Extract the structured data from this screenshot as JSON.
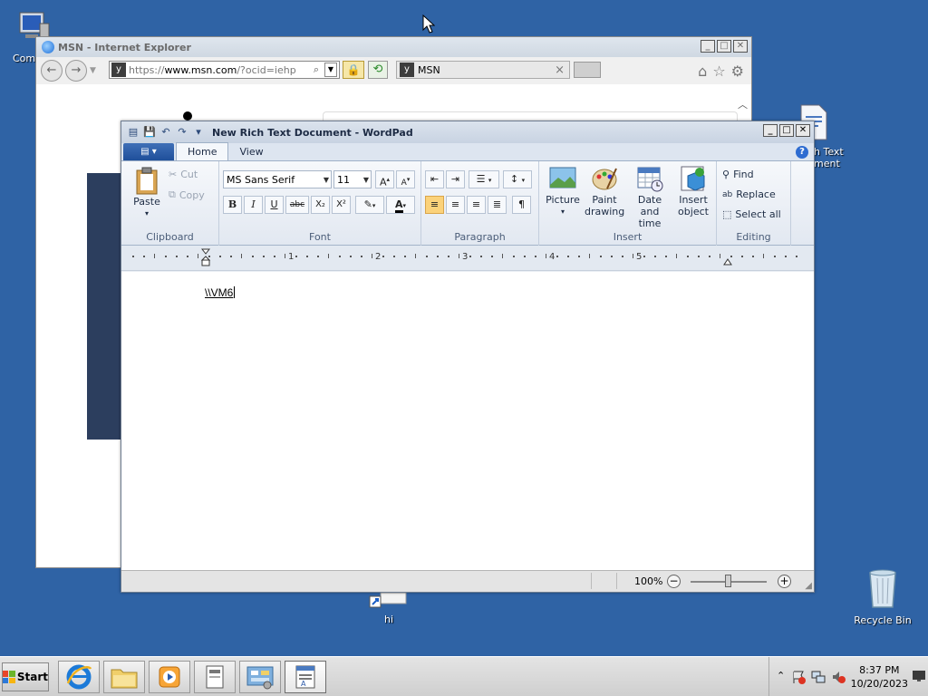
{
  "desktop": {
    "computer_label": "Comp",
    "rtf_label_line1": "h Text",
    "rtf_label_line2": "ment",
    "hi_label": "hi",
    "recycle_label": "Recycle Bin"
  },
  "ie": {
    "title": "MSN - Internet Explorer",
    "url_prefix": "https://",
    "url_domain": "www.msn.com",
    "url_path": "/?ocid=iehp",
    "tab_title": "MSN",
    "tab_close": "×"
  },
  "wordpad": {
    "title": "New Rich Text Document - WordPad",
    "tabs": [
      {
        "label": "Home",
        "active": true
      },
      {
        "label": "View",
        "active": false
      }
    ],
    "clipboard": {
      "paste": "Paste",
      "cut": "Cut",
      "copy": "Copy",
      "group_label": "Clipboard"
    },
    "font": {
      "family": "MS Sans Serif",
      "size": "11",
      "group_label": "Font",
      "buttons": [
        "B",
        "I",
        "U",
        "abc",
        "X₂",
        "X²"
      ]
    },
    "paragraph": {
      "group_label": "Paragraph"
    },
    "insert": {
      "picture": "Picture",
      "paint_line1": "Paint",
      "paint_line2": "drawing",
      "datetime_line1": "Date and",
      "datetime_line2": "time",
      "object_line1": "Insert",
      "object_line2": "object",
      "group_label": "Insert"
    },
    "editing": {
      "find": "Find",
      "replace": "Replace",
      "select_all": "Select all",
      "group_label": "Editing"
    },
    "ruler_numbers": [
      "1",
      "2",
      "3",
      "4",
      "5"
    ],
    "document_text": "\\\\VM6",
    "zoom": "100%",
    "zoom_level": 0.5
  },
  "taskbar": {
    "start_label": "Start",
    "time": "8:37 PM",
    "date": "10/20/2023"
  },
  "colors": {
    "desktop": "#2f63a5",
    "wordpad_accent": "#1f4f9a",
    "active_align": "#fbd27a"
  }
}
